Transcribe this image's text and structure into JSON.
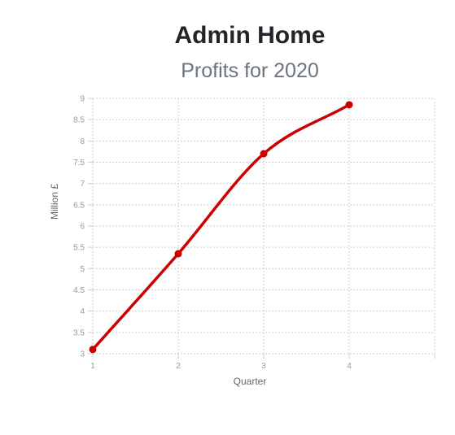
{
  "header": {
    "title": "Admin Home",
    "subtitle": "Profits for 2020"
  },
  "chart_data": {
    "type": "line",
    "x": [
      1,
      2,
      3,
      4
    ],
    "series": [
      {
        "values": [
          3.1,
          5.35,
          7.7,
          8.85
        ],
        "color": "#cc0000"
      }
    ],
    "xlabel": "Quarter",
    "ylabel": "Million £",
    "xlim": [
      1,
      5
    ],
    "ylim": [
      3,
      9
    ],
    "x_ticks": [
      "1",
      "2",
      "3",
      "4"
    ],
    "y_ticks": [
      "3",
      "3.5",
      "4",
      "4.5",
      "5",
      "5.5",
      "6",
      "6.5",
      "7",
      "7.5",
      "8",
      "8.5",
      "9"
    ],
    "grid": true
  }
}
